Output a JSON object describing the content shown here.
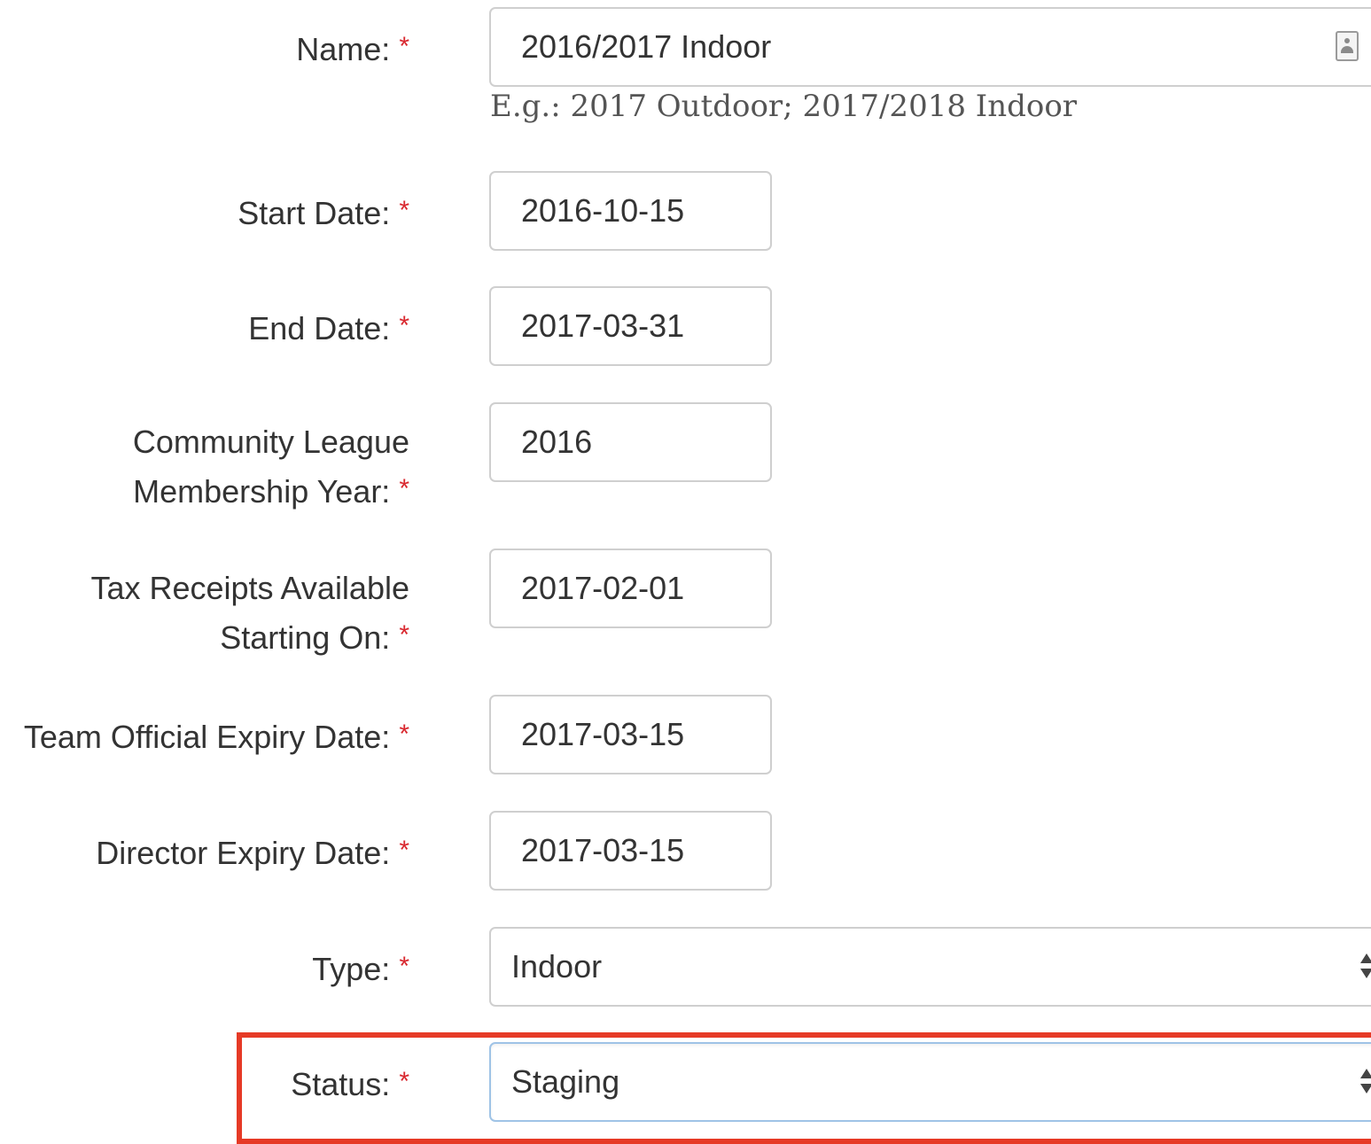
{
  "form": {
    "required_marker": "*",
    "name": {
      "label": "Name:",
      "value": "2016/2017 Indoor",
      "help_text": "E.g.: 2017 Outdoor; 2017/2018 Indoor",
      "icon": "contact-card-icon"
    },
    "start_date": {
      "label": "Start Date:",
      "value": "2016-10-15"
    },
    "end_date": {
      "label": "End Date:",
      "value": "2017-03-31"
    },
    "membership_year": {
      "label_line1": "Community League",
      "label_line2": "Membership Year:",
      "value": "2016"
    },
    "tax_receipts": {
      "label_line1": "Tax Receipts Available",
      "label_line2": "Starting On:",
      "value": "2017-02-01"
    },
    "team_official_expiry": {
      "label": "Team Official Expiry Date:",
      "value": "2017-03-15"
    },
    "director_expiry": {
      "label": "Director Expiry Date:",
      "value": "2017-03-15"
    },
    "type": {
      "label": "Type:",
      "selected": "Indoor"
    },
    "status": {
      "label": "Status:",
      "selected": "Staging"
    }
  },
  "colors": {
    "required_marker": "#d9282f",
    "highlight_outline": "#e63a26",
    "focused_border": "#9fc3e6"
  }
}
